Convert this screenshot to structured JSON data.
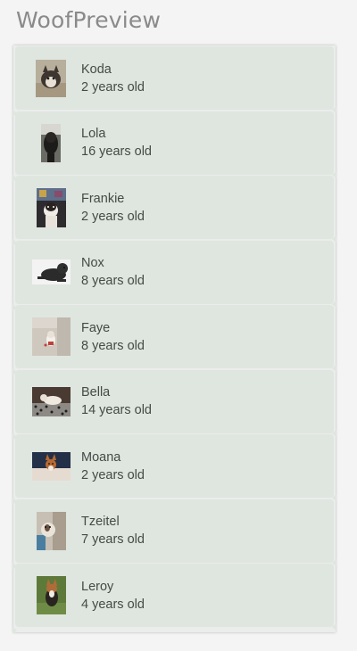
{
  "preview": {
    "title": "WoofPreview"
  },
  "dogs": [
    {
      "name": "Koda",
      "age": "2 years old",
      "photo": "dog-photo-koda"
    },
    {
      "name": "Lola",
      "age": "16 years old",
      "photo": "dog-photo-lola"
    },
    {
      "name": "Frankie",
      "age": "2 years old",
      "photo": "dog-photo-frankie"
    },
    {
      "name": "Nox",
      "age": "8 years old",
      "photo": "dog-photo-nox"
    },
    {
      "name": "Faye",
      "age": "8 years old",
      "photo": "dog-photo-faye"
    },
    {
      "name": "Bella",
      "age": "14 years old",
      "photo": "dog-photo-bella"
    },
    {
      "name": "Moana",
      "age": "2 years old",
      "photo": "dog-photo-moana"
    },
    {
      "name": "Tzeitel",
      "age": "7 years old",
      "photo": "dog-photo-tzeitel"
    },
    {
      "name": "Leroy",
      "age": "4 years old",
      "photo": "dog-photo-leroy"
    }
  ],
  "colors": {
    "card_background": "#dfe6df",
    "text": "#444b46",
    "title": "#8a8a8a"
  }
}
